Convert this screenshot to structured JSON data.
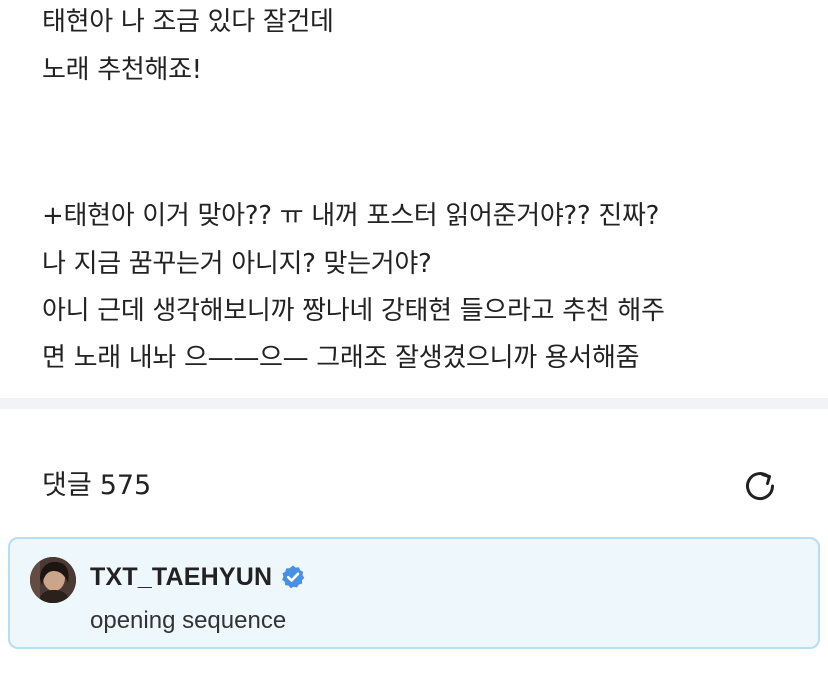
{
  "post": {
    "lines": [
      "태현아 나 조금 있다 잘건데",
      "노래 추천해죠!",
      "+태현아 이거 맞아?? ㅠ 내꺼 포스터 읽어준거야?? 진짜?",
      "나 지금 꿈꾸는거 아니지? 맞는거야?",
      "아니 근데 생각해보니까 짱나네 강태현 들으라고 추천 해주",
      "면 노래 내놔 으——으— 그래조 잘생겼으니까 용서해줌"
    ]
  },
  "comments": {
    "label": "댓글",
    "count": "575",
    "refresh_icon": "refresh-icon"
  },
  "highlight_comment": {
    "author": "TXT_TAEHYUN",
    "verified_icon": "verified-badge-icon",
    "text": "opening sequence",
    "background": "#eef7fc",
    "border": "#b7def3",
    "badge_color": "#4a90e2"
  },
  "colors": {
    "text": "#222222",
    "divider": "#f1f3f6"
  }
}
